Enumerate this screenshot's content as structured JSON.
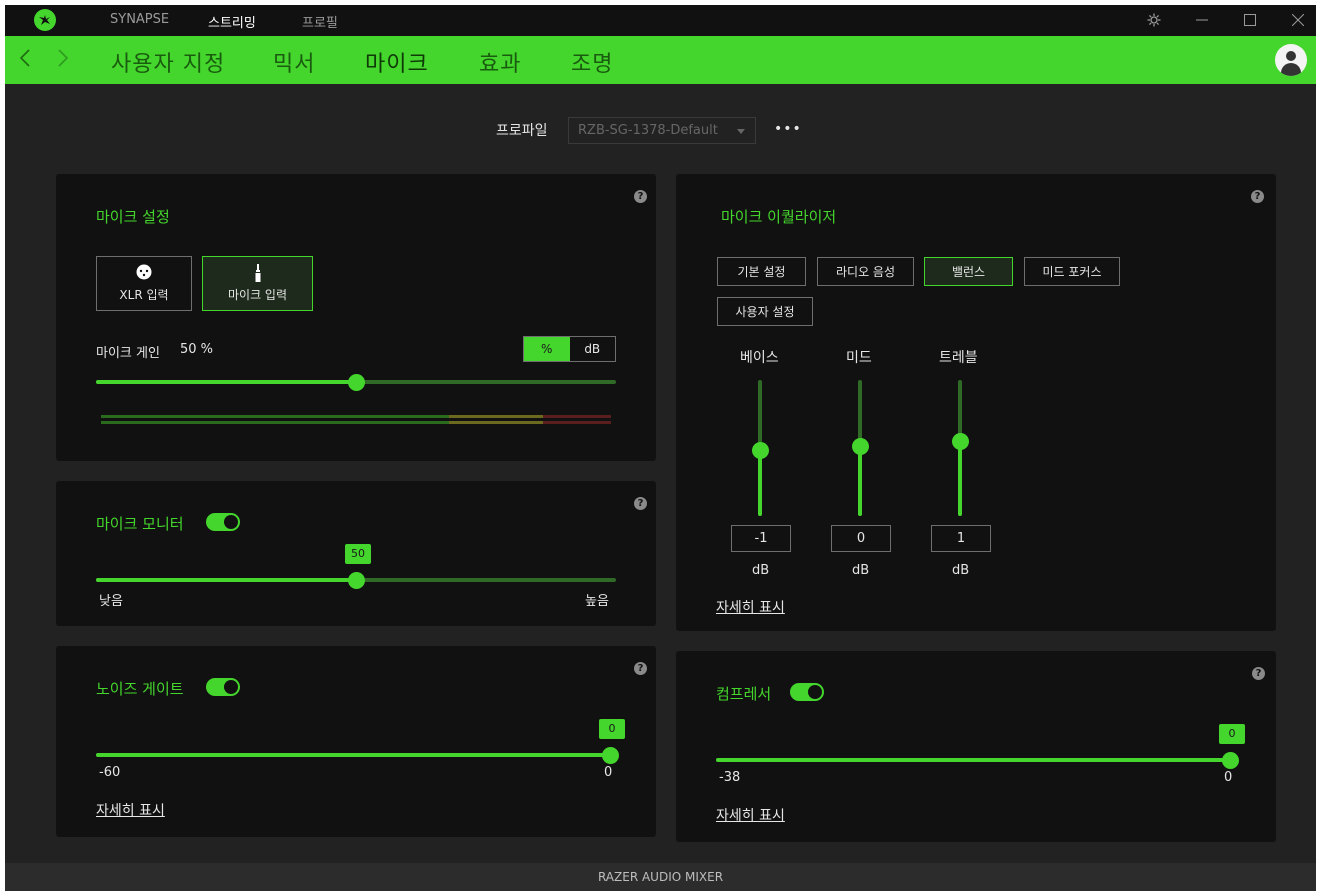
{
  "topbar": {
    "nav": [
      "SYNAPSE",
      "스트리밍",
      "프로필"
    ],
    "active_nav": "스트리밍"
  },
  "subnav": {
    "tabs": [
      "사용자 지정",
      "믹서",
      "마이크",
      "효과",
      "조명"
    ],
    "active_tab": "마이크"
  },
  "profile": {
    "label": "프로파일",
    "selected": "RZB-SG-1378-Default",
    "more": "•••"
  },
  "mic_settings": {
    "title": "마이크 설정",
    "help": "?",
    "inputs": [
      {
        "label": "XLR 입력",
        "icon": "xlr-connector-icon",
        "selected": false
      },
      {
        "label": "마이크 입력",
        "icon": "jack-connector-icon",
        "selected": true
      }
    ],
    "gain_label": "마이크 게인",
    "gain_value": "50 %",
    "gain_fraction": 0.5,
    "unit_options": [
      "%",
      "dB"
    ],
    "unit_selected": "%"
  },
  "mic_monitor": {
    "title": "마이크 모니터",
    "help": "?",
    "enabled": true,
    "value": "50",
    "fraction": 0.5,
    "min_label": "낮음",
    "max_label": "높음"
  },
  "noise_gate": {
    "title": "노이즈 게이트",
    "help": "?",
    "enabled": true,
    "value": "0",
    "fraction": 1.0,
    "min_label": "-60",
    "max_label": "0",
    "details": "자세히 표시"
  },
  "equalizer": {
    "title": "마이크 이퀄라이저",
    "help": "?",
    "presets": [
      "기본 설정",
      "라디오 음성",
      "밸런스",
      "미드 포커스",
      "사용자 설정"
    ],
    "selected_preset": "밸런스",
    "bands": [
      {
        "label": "베이스",
        "value": "-1",
        "unit": "dB",
        "fraction": 0.48
      },
      {
        "label": "미드",
        "value": "0",
        "unit": "dB",
        "fraction": 0.51
      },
      {
        "label": "트레블",
        "value": "1",
        "unit": "dB",
        "fraction": 0.55
      }
    ],
    "details": "자세히 표시"
  },
  "compressor": {
    "title": "컴프레서",
    "help": "?",
    "enabled": true,
    "value": "0",
    "fraction": 1.0,
    "min_label": "-38",
    "max_label": "0",
    "details": "자세히 표시"
  },
  "footer": {
    "device": "RAZER AUDIO MIXER"
  },
  "colors": {
    "accent": "#44d62c",
    "background": "#222222",
    "card": "#111111"
  }
}
